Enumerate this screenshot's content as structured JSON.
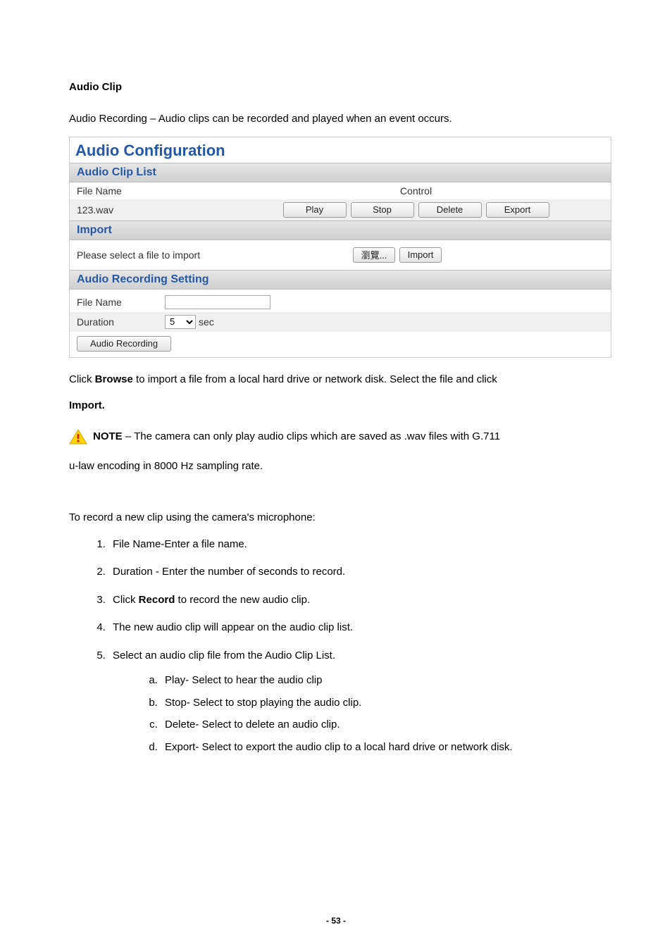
{
  "doc": {
    "heading1": "Audio Clip",
    "para1": "Audio Recording – Audio clips can be recorded and played when an event occurs.",
    "afterUi1a": "Click ",
    "afterUi1b": "Browse",
    "afterUi1c": " to import a file from a local hard drive or network disk.   Select the file and click",
    "afterUi2": "Import.",
    "noteLabel": "NOTE",
    "noteText1": " – The camera can only play audio clips which are saved as .wav files with G.711",
    "noteText2": "u-law encoding in 8000 Hz sampling rate.",
    "para2": "To record a new clip using the camera's microphone:",
    "list": [
      "File Name-Enter a file name.",
      "Duration - Enter the number of seconds to record.",
      {
        "pre": "Click ",
        "bold": "Record",
        "post": " to record the new audio clip."
      },
      "The new audio clip will appear on the audio clip list.",
      "Select an audio clip file from the Audio Clip List."
    ],
    "sublist": [
      "Play- Select to hear the audio clip",
      "Stop- Select to stop playing the audio clip.",
      "Delete- Select to delete an audio clip.",
      "Export- Select to export the audio clip to a local hard drive or network disk."
    ],
    "pageNum": "- 53 -"
  },
  "ui": {
    "title": "Audio Configuration",
    "section1": "Audio Clip List",
    "col_file": "File Name",
    "col_control": "Control",
    "clipName": "123.wav",
    "btnPlay": "Play",
    "btnStop": "Stop",
    "btnDelete": "Delete",
    "btnExport": "Export",
    "section2": "Import",
    "importLabel": "Please select a file to import",
    "btnBrowse": "瀏覽...",
    "btnImport": "Import",
    "section3": "Audio Recording Setting",
    "recFileLabel": "File Name",
    "recFileValue": "",
    "durationLabel": "Duration",
    "durationValue": "5",
    "durationUnit": "sec",
    "btnRecord": "Audio Recording"
  }
}
